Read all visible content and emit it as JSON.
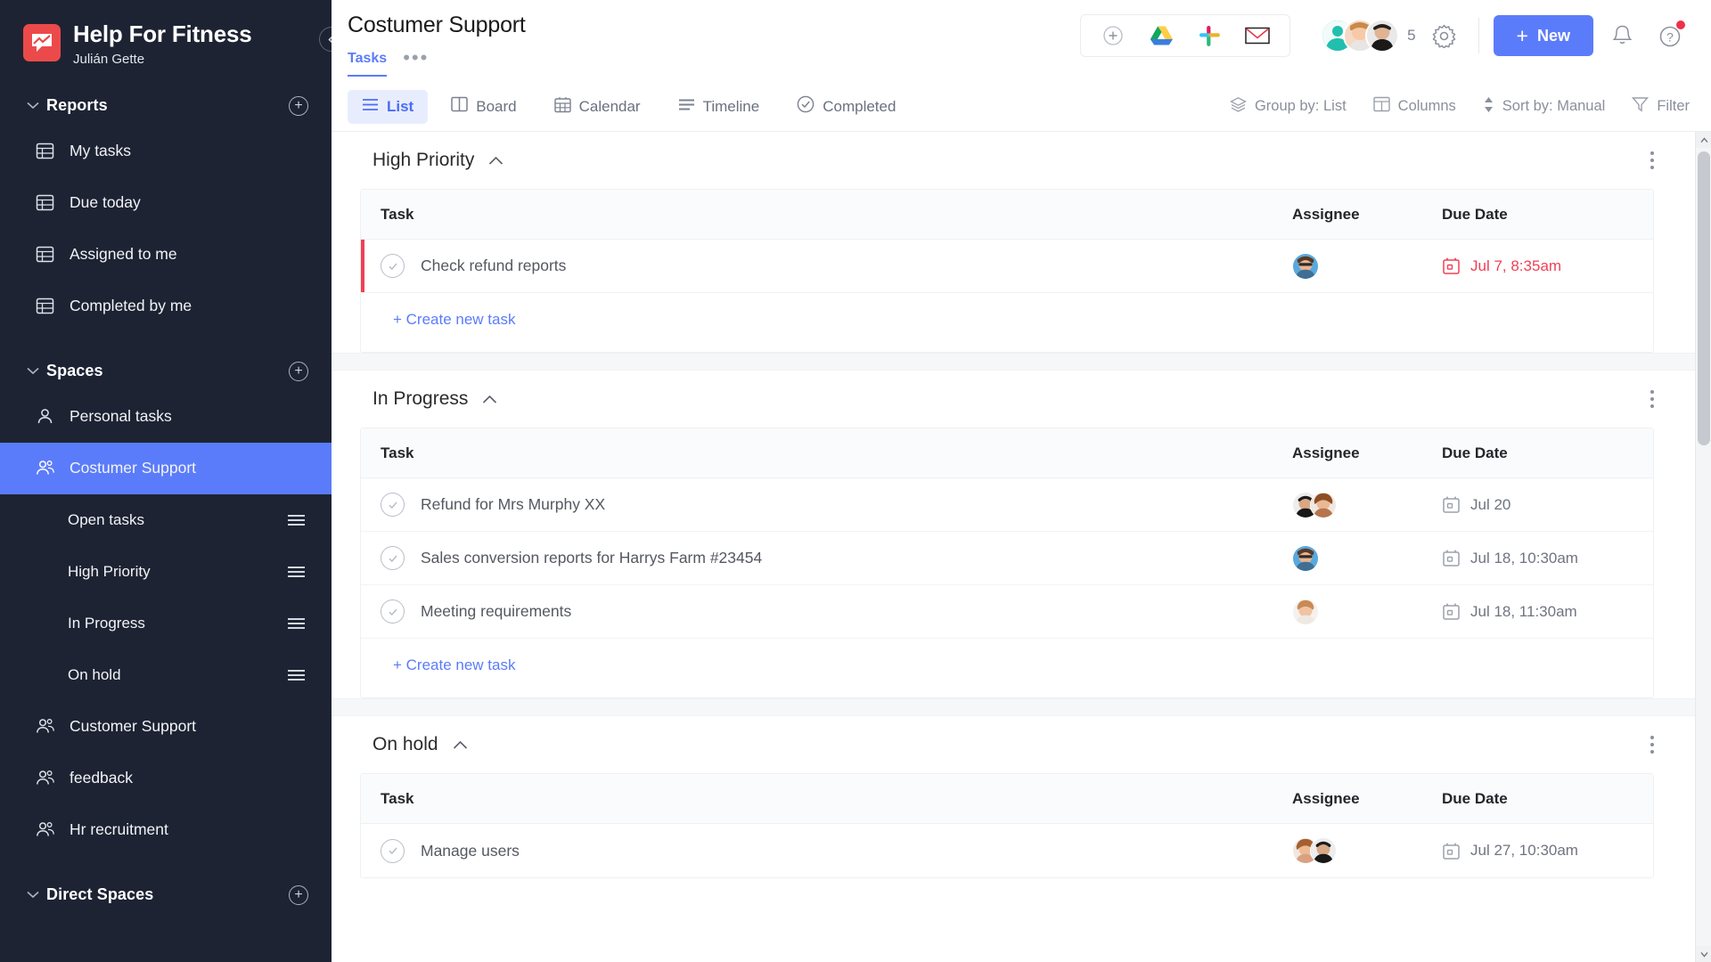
{
  "sidebar": {
    "brand": {
      "title": "Help For Fitness",
      "user": "Julián Gette",
      "logo_color": "#ec4a4a"
    },
    "collapse_tooltip": "Collapse",
    "groups": [
      {
        "label": "Reports",
        "items": [
          {
            "label": "My tasks",
            "icon": "table-icon"
          },
          {
            "label": "Due today",
            "icon": "table-icon"
          },
          {
            "label": "Assigned to me",
            "icon": "table-icon"
          },
          {
            "label": "Completed by me",
            "icon": "table-icon"
          }
        ]
      },
      {
        "label": "Spaces",
        "items": [
          {
            "label": "Personal tasks",
            "icon": "user-icon",
            "active": false,
            "sub": false
          },
          {
            "label": "Costumer Support",
            "icon": "users-icon",
            "active": true,
            "sub": false
          },
          {
            "label": "Open tasks",
            "icon": "",
            "active": false,
            "sub": true
          },
          {
            "label": "High Priority",
            "icon": "",
            "active": false,
            "sub": true
          },
          {
            "label": "In Progress",
            "icon": "",
            "active": false,
            "sub": true
          },
          {
            "label": "On hold",
            "icon": "",
            "active": false,
            "sub": true
          },
          {
            "label": "Customer Support",
            "icon": "users-icon",
            "active": false,
            "sub": false
          },
          {
            "label": "feedback",
            "icon": "users-icon",
            "active": false,
            "sub": false
          },
          {
            "label": "Hr recruitment",
            "icon": "users-icon",
            "active": false,
            "sub": false
          }
        ]
      },
      {
        "label": "Direct Spaces",
        "items": []
      }
    ],
    "active_color": "#5b7cfa"
  },
  "header": {
    "title": "Costumer Support",
    "subtabs": {
      "tasks": "Tasks",
      "more": "•••"
    },
    "integrations": [
      "add-integration-icon",
      "google-drive-icon",
      "slack-icon",
      "mail-icon"
    ],
    "member_count": "5",
    "new_button": "New",
    "new_button_color": "#5b7cfa"
  },
  "viewbar": {
    "tabs": [
      {
        "label": "List",
        "icon": "list-icon",
        "active": true
      },
      {
        "label": "Board",
        "icon": "board-icon",
        "active": false
      },
      {
        "label": "Calendar",
        "icon": "calendar-icon",
        "active": false
      },
      {
        "label": "Timeline",
        "icon": "timeline-icon",
        "active": false
      },
      {
        "label": "Completed",
        "icon": "check-circle-icon",
        "active": false
      }
    ],
    "tools": [
      {
        "label": "Group by: List",
        "icon": "layers-icon"
      },
      {
        "label": "Columns",
        "icon": "columns-icon"
      },
      {
        "label": "Sort by: Manual",
        "icon": "sort-icon"
      },
      {
        "label": "Filter",
        "icon": "filter-icon"
      }
    ]
  },
  "columns": {
    "task": "Task",
    "assignee": "Assignee",
    "due": "Due Date"
  },
  "create_task_label": "+ Create new task",
  "groups": [
    {
      "title": "High Priority",
      "rows": [
        {
          "name": "Check refund reports",
          "due": "Jul 7, 8:35am",
          "overdue": true,
          "priority": true,
          "avatars": [
            "#3d7fc1"
          ]
        }
      ]
    },
    {
      "title": "In Progress",
      "rows": [
        {
          "name": "Refund for Mrs Murphy XX",
          "due": "Jul 20",
          "overdue": false,
          "priority": false,
          "avatars": [
            "#2d2d33",
            "#b5744c"
          ]
        },
        {
          "name": "Sales conversion reports for Harrys Farm #23454",
          "due": "Jul 18, 10:30am",
          "overdue": false,
          "priority": false,
          "avatars": [
            "#3d7fc1"
          ]
        },
        {
          "name": "Meeting requirements",
          "due": "Jul 18, 11:30am",
          "overdue": false,
          "priority": false,
          "avatars": [
            "#e8b9a0"
          ]
        }
      ]
    },
    {
      "title": "On hold",
      "rows": [
        {
          "name": "Manage users",
          "due": "Jul 27, 10:30am",
          "overdue": false,
          "priority": false,
          "avatars": [
            "#d8a282",
            "#2d2d33"
          ]
        }
      ]
    }
  ],
  "colors": {
    "accent": "#5b7cfa",
    "overdue": "#ef4056",
    "sidebar_bg": "#1d2333",
    "priority_bar": "#ef4056"
  }
}
